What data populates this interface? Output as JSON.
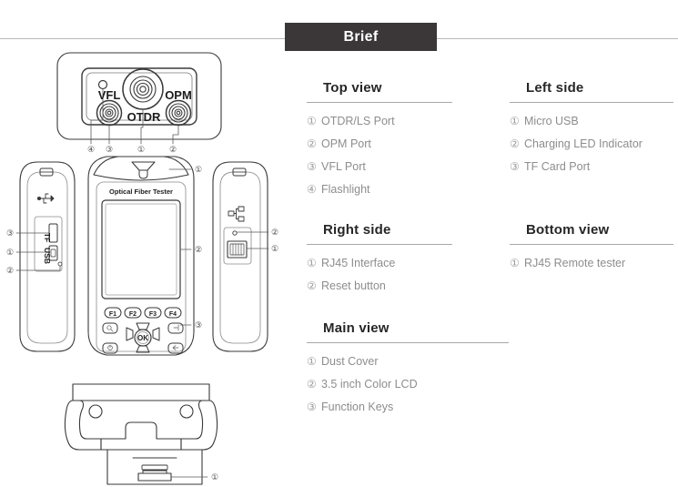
{
  "header": {
    "title": "Brief"
  },
  "sections": [
    {
      "id": "top-view",
      "title": "Top view",
      "items": [
        {
          "num": "①",
          "label": "OTDR/LS Port"
        },
        {
          "num": "②",
          "label": "OPM Port"
        },
        {
          "num": "③",
          "label": "VFL Port"
        },
        {
          "num": "④",
          "label": "Flashlight"
        }
      ]
    },
    {
      "id": "left-side",
      "title": "Left side",
      "items": [
        {
          "num": "①",
          "label": "Micro USB"
        },
        {
          "num": "②",
          "label": "Charging LED Indicator"
        },
        {
          "num": "③",
          "label": "TF Card Port"
        }
      ]
    },
    {
      "id": "right-side",
      "title": "Right side",
      "items": [
        {
          "num": "①",
          "label": "RJ45 Interface"
        },
        {
          "num": "②",
          "label": "Reset button"
        }
      ]
    },
    {
      "id": "bottom-view",
      "title": "Bottom view",
      "items": [
        {
          "num": "①",
          "label": "RJ45 Remote tester"
        }
      ]
    },
    {
      "id": "main-view",
      "title": "Main view",
      "items": [
        {
          "num": "①",
          "label": "Dust Cover"
        },
        {
          "num": "②",
          "label": "3.5 inch Color LCD"
        },
        {
          "num": "③",
          "label": "Function Keys"
        }
      ]
    }
  ],
  "illustration": {
    "top_view": {
      "port_labels": {
        "vfl": "VFL",
        "otdr": "OTDR",
        "opm": "OPM"
      },
      "callouts": [
        "④",
        "③",
        "①",
        "②"
      ]
    },
    "main_view": {
      "brand_label": "Optical Fiber Tester",
      "function_keys": [
        "F1",
        "F2",
        "F3",
        "F4"
      ],
      "ok_key": "OK",
      "callouts": [
        "①",
        "②",
        "③"
      ]
    },
    "left_view": {
      "port_labels": {
        "tf": "TF",
        "usb": "USB"
      },
      "callouts": [
        "③",
        "①",
        "②"
      ]
    },
    "right_view": {
      "callouts": [
        "②",
        "①"
      ]
    },
    "bottom_view": {
      "callouts": [
        "①"
      ]
    }
  },
  "colors": {
    "header_bar": "#3b3738",
    "heading_text": "#262626",
    "body_text": "#8d8d8d",
    "rule": "#a8a8a8",
    "line_art": "#3a3a3a"
  }
}
